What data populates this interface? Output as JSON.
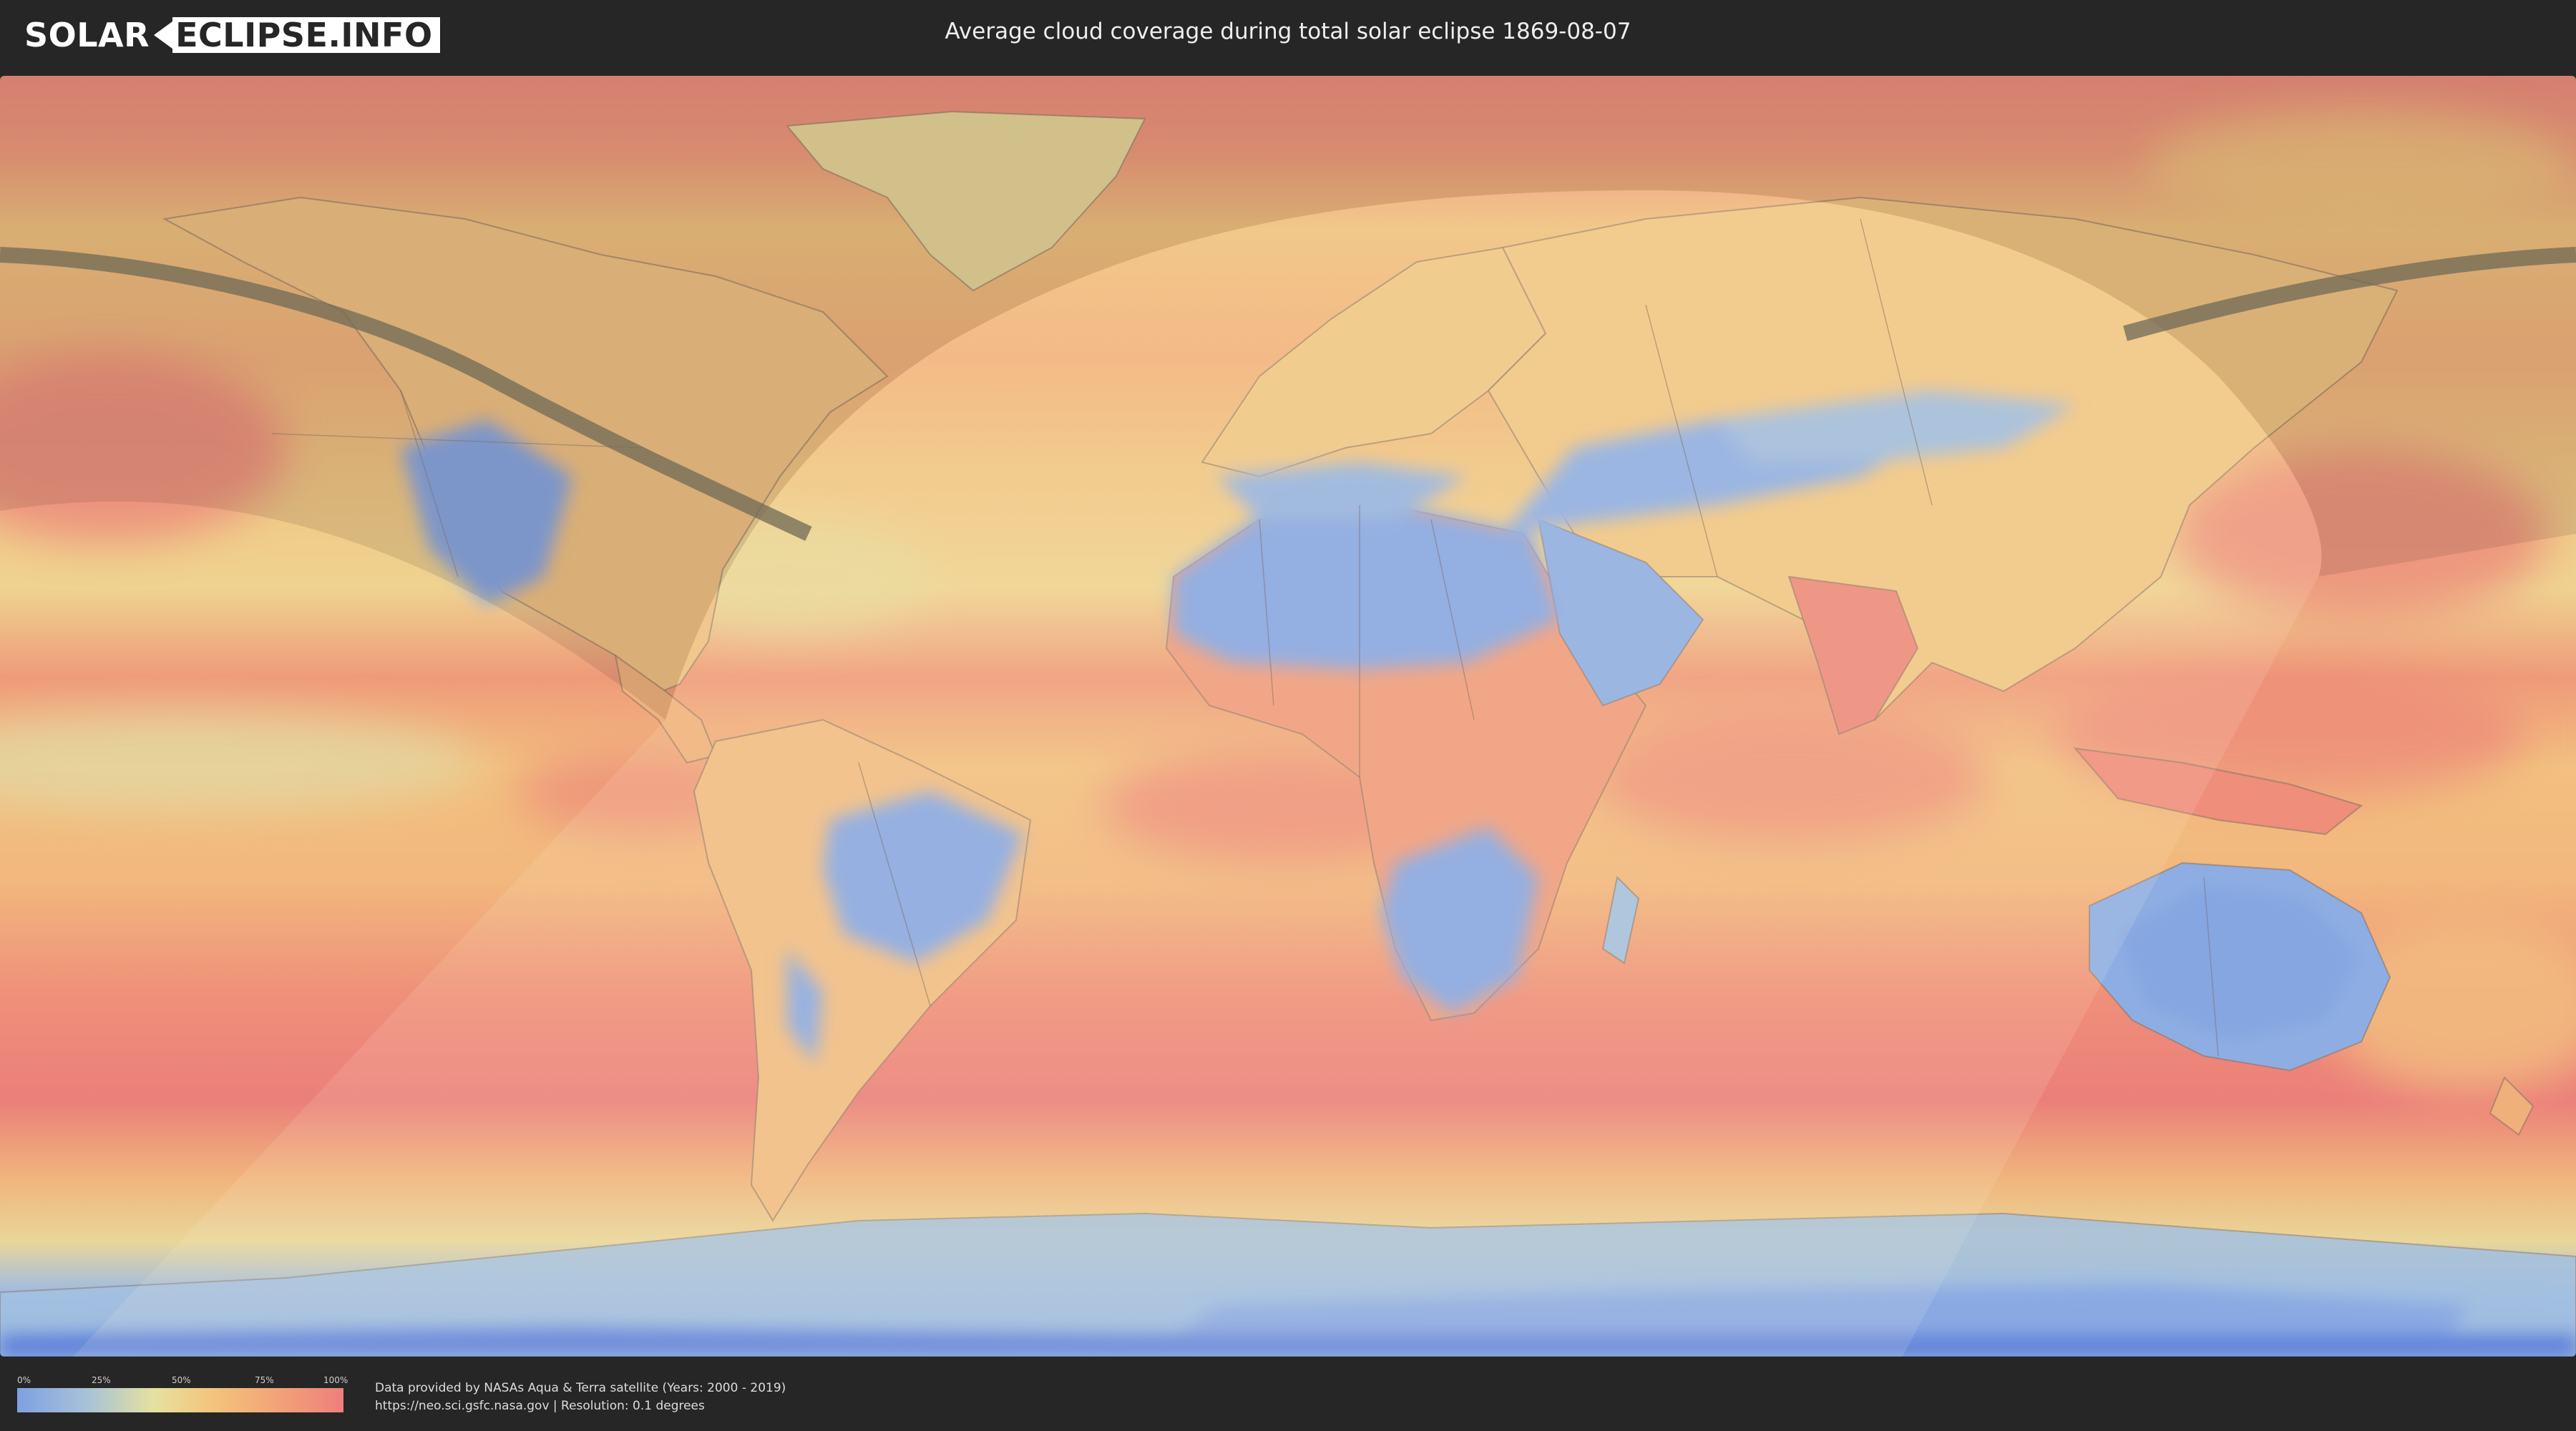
{
  "header": {
    "logo_left": "SOLAR",
    "logo_right": "ECLIPSE.INFO",
    "title": "Average cloud coverage during total solar eclipse 1869-08-07"
  },
  "legend": {
    "ticks": [
      "0%",
      "25%",
      "50%",
      "75%",
      "100%"
    ],
    "colors": [
      "#7fa0e3",
      "#a9c3d6",
      "#e6e1a0",
      "#f3c47c",
      "#f3a278",
      "#ee7f7b"
    ]
  },
  "credits": {
    "line1": "Data provided by NASAs Aqua & Terra satellite (Years: 2000 - 2019)",
    "line2": "https://neo.sci.gsfc.nasa.gov | Resolution: 0.1 degrees"
  },
  "map": {
    "layers": [
      "cloud-coverage",
      "continent-borders",
      "eclipse-visibility-area",
      "totality-path"
    ],
    "colors": {
      "low": "#7fa0e3",
      "mid": "#f0d89a",
      "high": "#ee7f7b",
      "path": "#6f6a55"
    }
  }
}
